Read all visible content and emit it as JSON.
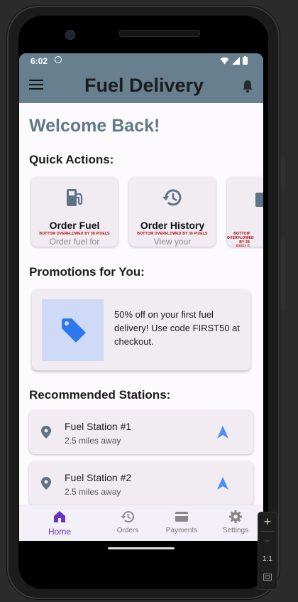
{
  "status_bar": {
    "time": "6:02"
  },
  "app_bar": {
    "title": "Fuel Delivery"
  },
  "welcome": "Welcome Back!",
  "quick_actions": {
    "title": "Quick Actions:",
    "overflow_text": "BOTTOM OVERFLOWED BY 38 PIXELS",
    "items": [
      {
        "label": "Order Fuel",
        "subtitle": "Order fuel for",
        "icon": "fuel-pump-icon"
      },
      {
        "label": "Order History",
        "subtitle": "View your",
        "icon": "history-icon"
      },
      {
        "label": "",
        "subtitle": "",
        "icon": "card-icon"
      }
    ]
  },
  "promotions": {
    "title": "Promotions for You:",
    "text": "50% off on your first fuel delivery! Use code FIRST50 at checkout.",
    "icon": "tag-icon"
  },
  "stations": {
    "title": "Recommended Stations:",
    "items": [
      {
        "name": "Fuel Station #1",
        "distance": "2.5 miles away"
      },
      {
        "name": "Fuel Station #2",
        "distance": "2.5 miles away"
      }
    ]
  },
  "bottom_nav": {
    "items": [
      {
        "label": "Home",
        "icon": "home-icon",
        "active": true
      },
      {
        "label": "Orders",
        "icon": "history-icon",
        "active": false
      },
      {
        "label": "Payments",
        "icon": "credit-card-icon",
        "active": false
      },
      {
        "label": "Settings",
        "icon": "gear-icon",
        "active": false
      }
    ]
  },
  "emulator_controls": {
    "zoom_in": "+",
    "zoom_out": "−",
    "actual_size": "1:1"
  },
  "colors": {
    "app_bar": "#66808f",
    "welcome": "#5e7a85",
    "accent": "#6a35b8",
    "nav_arrow": "#4c8df6",
    "promo_bg": "#cfdaf7"
  }
}
